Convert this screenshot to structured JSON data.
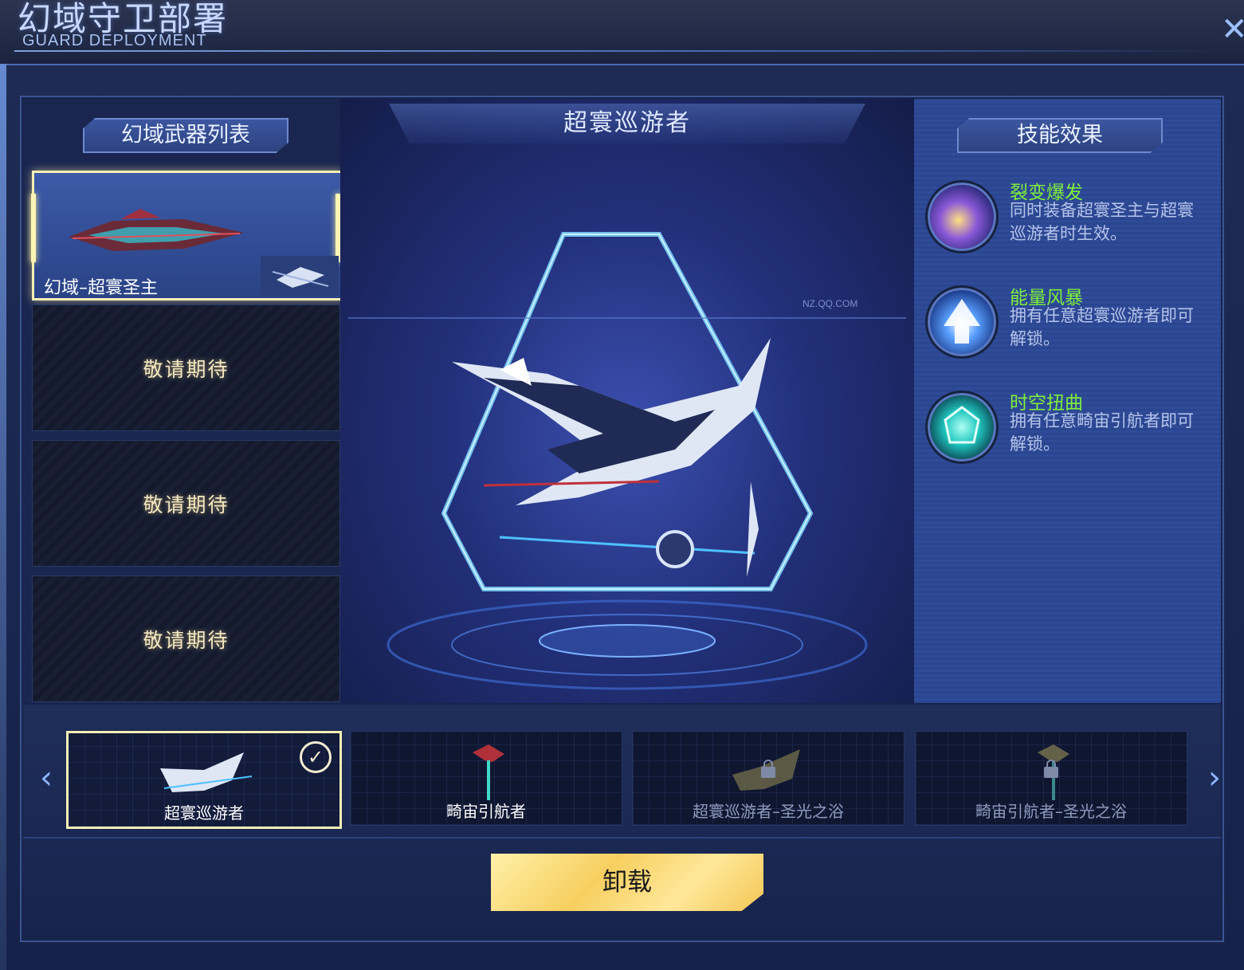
{
  "header": {
    "title": "幻域守卫部署",
    "subtitle": "GUARD DEPLOYMENT",
    "close_label": "✕"
  },
  "weapon_list": {
    "title": "幻域武器列表",
    "slots": [
      {
        "label": "幻域–超寰圣主",
        "state": "active"
      },
      {
        "label": "敬请期待",
        "state": "empty"
      },
      {
        "label": "敬请期待",
        "state": "empty"
      },
      {
        "label": "敬请期待",
        "state": "empty"
      }
    ]
  },
  "preview": {
    "weapon_name": "超寰巡游者",
    "watermark": "NZ.QQ.COM"
  },
  "skills": {
    "title": "技能效果",
    "items": [
      {
        "name": "裂变爆发",
        "description": "同时装备超寰圣主与超寰巡游者时生效。",
        "icon": "lightning-orb-icon"
      },
      {
        "name": "能量风暴",
        "description": "拥有任意超寰巡游者即可解锁。",
        "icon": "up-arrow-orb-icon"
      },
      {
        "name": "时空扭曲",
        "description": "拥有任意畸宙引航者即可解锁。",
        "icon": "crystal-orb-icon"
      }
    ]
  },
  "variants": {
    "prev_label": "‹",
    "next_label": "›",
    "items": [
      {
        "name": "超寰巡游者",
        "selected": true,
        "locked": false
      },
      {
        "name": "畸宙引航者",
        "selected": false,
        "locked": false
      },
      {
        "name": "超寰巡游者–圣光之浴",
        "selected": false,
        "locked": true
      },
      {
        "name": "畸宙引航者–圣光之浴",
        "selected": false,
        "locked": true
      }
    ]
  },
  "actions": {
    "unload_label": "卸载"
  },
  "colors": {
    "accent_gold": "#f5eeb3",
    "skill_name_green": "#7ff03c",
    "panel_blue": "#2f4b98"
  }
}
